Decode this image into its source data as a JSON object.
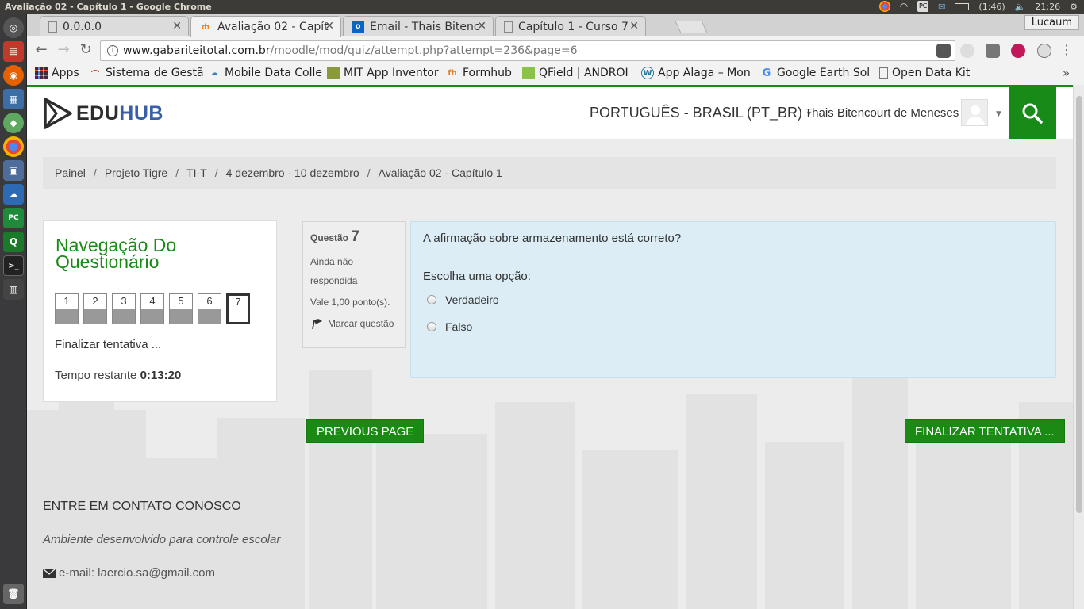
{
  "system": {
    "window_title": "Avaliação 02 - Capítulo 1 - Google Chrome",
    "battery": "(1:46)",
    "clock": "21:26",
    "user": "Lucaum"
  },
  "tabs": [
    {
      "label": "0.0.0.0"
    },
    {
      "label": "Avaliação 02 - Capít"
    },
    {
      "label": "Email - Thais Bitenc"
    },
    {
      "label": "Capítulo 1 - Curso 7"
    }
  ],
  "address": {
    "host": "www.gabariteitotal.com.br",
    "path": "/moodle/mod/quiz/attempt.php?attempt=236&page=6"
  },
  "bookmarks": [
    {
      "label": "Apps"
    },
    {
      "label": "Sistema de Gestã"
    },
    {
      "label": "Mobile Data Colle"
    },
    {
      "label": "MIT App Inventor"
    },
    {
      "label": "Formhub"
    },
    {
      "label": "QField | ANDROI"
    },
    {
      "label": "App Alaga – Mon"
    },
    {
      "label": "Google Earth Sol"
    },
    {
      "label": "Open Data Kit"
    }
  ],
  "header": {
    "logo_edu": "EDU",
    "logo_hub": "HUB",
    "language": "PORTUGUÊS - BRASIL (PT_BR)",
    "username": "Thais Bitencourt de Meneses"
  },
  "breadcrumb": [
    "Painel",
    "Projeto Tigre",
    "TI-T",
    "4 dezembro - 10 dezembro",
    "Avaliação 02 - Capítulo 1"
  ],
  "quiz_nav": {
    "title": "Navegação Do Questionário",
    "questions": [
      "1",
      "2",
      "3",
      "4",
      "5",
      "6",
      "7"
    ],
    "finish_link": "Finalizar tentativa ...",
    "time_label": "Tempo restante",
    "time_value": "0:13:20"
  },
  "question": {
    "label": "Questão",
    "number": "7",
    "state": "Ainda não respondida",
    "grade": "Vale 1,00 ponto(s).",
    "flag_label": "Marcar questão",
    "text": "A afirmação sobre armazenamento está correto?",
    "prompt": "Escolha uma opção:",
    "options": [
      "Verdadeiro",
      "Falso"
    ]
  },
  "buttons": {
    "previous": "PREVIOUS PAGE",
    "finish": "FINALIZAR TENTATIVA ..."
  },
  "footer": {
    "title": "ENTRE EM CONTATO CONOSCO",
    "description": "Ambiente desenvolvido para controle escolar",
    "email": "e-mail: laercio.sa@gmail.com"
  },
  "colors": {
    "brand_green": "#188a17",
    "question_bg": "#dcedf5",
    "logo_blue": "#3a5fa8"
  }
}
